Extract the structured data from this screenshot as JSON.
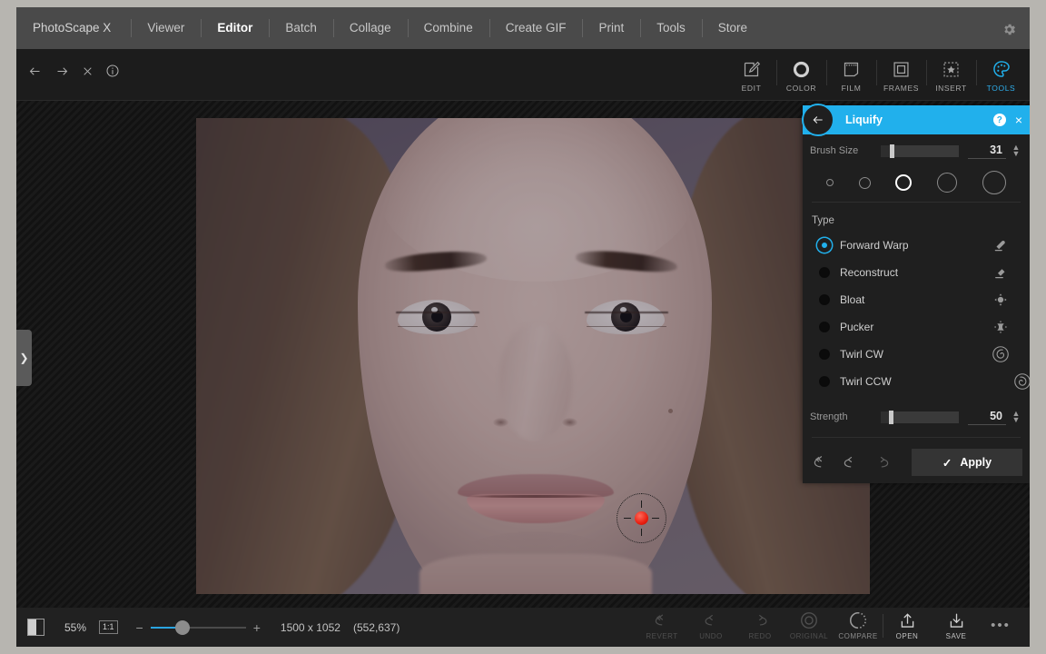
{
  "app": {
    "brand": "PhotoScape X",
    "menu": [
      "Viewer",
      "Editor",
      "Batch",
      "Collage",
      "Combine",
      "Create GIF",
      "Print",
      "Tools",
      "Store"
    ],
    "active_menu": "Editor",
    "gear_icon": "gear-icon"
  },
  "subbar": {
    "nav": [
      "back-arrow-icon",
      "forward-arrow-icon",
      "close-icon",
      "info-icon"
    ],
    "tabs": [
      {
        "label": "EDIT",
        "icon": "pencil-square-icon"
      },
      {
        "label": "COLOR",
        "icon": "color-ring-icon"
      },
      {
        "label": "FILM",
        "icon": "film-strip-icon"
      },
      {
        "label": "FRAMES",
        "icon": "frame-square-icon"
      },
      {
        "label": "INSERT",
        "icon": "star-dashed-icon"
      },
      {
        "label": "TOOLS",
        "icon": "palette-icon"
      }
    ],
    "active_tab": "TOOLS",
    "accent": "#21b0ec"
  },
  "canvas": {
    "side_handle_icon": "chevron-right-icon",
    "brush_cursor": {
      "name": "liquify-brush-cursor",
      "dot_color": "#e81f10"
    }
  },
  "panel": {
    "title": "Liquify",
    "back_icon": "back-arrow-icon",
    "help_label": "?",
    "close_label": "×",
    "header_color": "#21b0ec",
    "brush_size": {
      "label": "Brush Size",
      "value": "31",
      "percent": 12
    },
    "brush_presets": [
      {
        "size": 8,
        "selected": false
      },
      {
        "size": 13,
        "selected": false
      },
      {
        "size": 18,
        "selected": true
      },
      {
        "size": 22,
        "selected": false
      },
      {
        "size": 26,
        "selected": false
      }
    ],
    "type_section": {
      "label": "Type",
      "options": [
        {
          "label": "Forward Warp",
          "icon": "forward-warp-icon",
          "selected": true
        },
        {
          "label": "Reconstruct",
          "icon": "reconstruct-icon",
          "selected": false
        },
        {
          "label": "Bloat",
          "icon": "bloat-icon",
          "selected": false
        },
        {
          "label": "Pucker",
          "icon": "pucker-icon",
          "selected": false
        },
        {
          "label": "Twirl CW",
          "icon": "twirl-cw-icon",
          "selected": false
        },
        {
          "label": "Twirl CCW",
          "icon": "twirl-ccw-icon",
          "selected": false
        }
      ]
    },
    "strength": {
      "label": "Strength",
      "value": "50",
      "percent": 10
    },
    "footer": {
      "reset_icon": "reset-all-icon",
      "undo_icon": "undo-icon",
      "redo_icon": "redo-icon",
      "apply_label": "Apply",
      "apply_check": "✓"
    }
  },
  "bottombar": {
    "split_icon": "split-view-icon",
    "zoom_percent": "55%",
    "one_to_one": "1:1",
    "zoom_minus": "−",
    "zoom_plus": "+",
    "zoom_slider_percent": 30,
    "dimensions": "1500 x 1052",
    "coordinates": "(552,637)",
    "actions": [
      {
        "label": "REVERT",
        "icon": "revert-icon",
        "state": "dim"
      },
      {
        "label": "UNDO",
        "icon": "undo-icon",
        "state": "dim"
      },
      {
        "label": "REDO",
        "icon": "redo-icon",
        "state": "dim"
      },
      {
        "label": "ORIGINAL",
        "icon": "original-icon",
        "state": "dim"
      },
      {
        "label": "COMPARE",
        "icon": "compare-icon",
        "state": "normal"
      },
      {
        "label": "OPEN",
        "icon": "open-upload-icon",
        "state": "bright"
      },
      {
        "label": "SAVE",
        "icon": "save-download-icon",
        "state": "bright"
      }
    ],
    "more_label": "•••"
  }
}
